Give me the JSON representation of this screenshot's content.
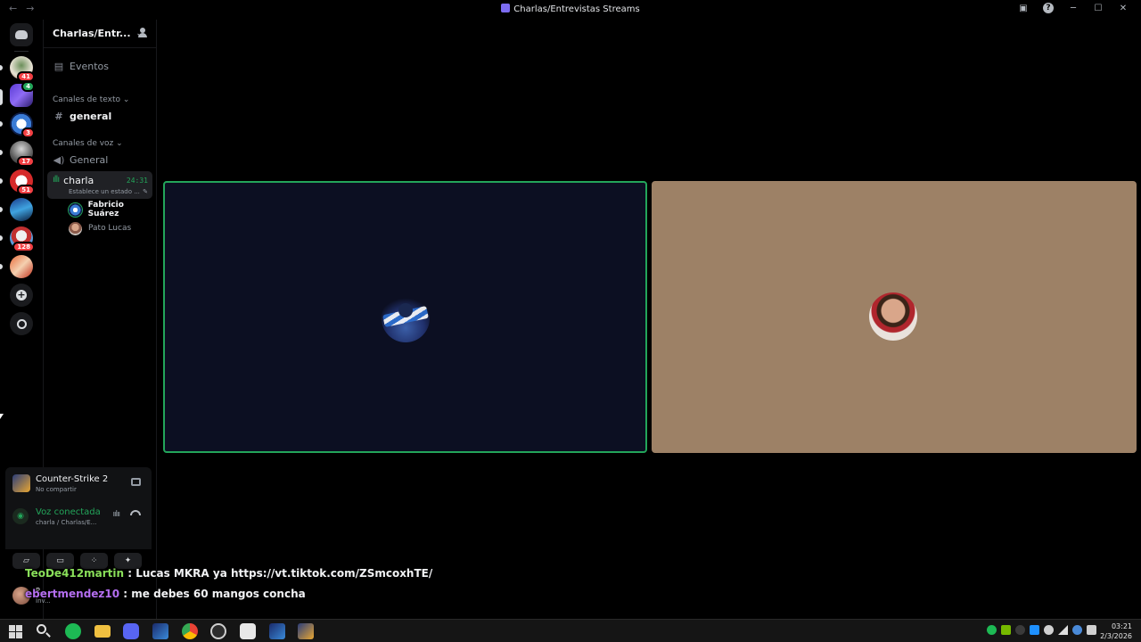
{
  "window": {
    "title": "Charlas/Entrevistas Streams",
    "back": "←",
    "forward": "→",
    "inbox_icon": "inbox-icon",
    "help": "?",
    "minimize": "─",
    "maximize": "☐",
    "close": "✕"
  },
  "rail": {
    "badges": [
      "41",
      "",
      "3",
      "17",
      "51",
      "",
      "128",
      ""
    ],
    "mention_badge": "4"
  },
  "guild": {
    "name": "Charlas/Entr...",
    "events_label": "Eventos",
    "text_category": "Canales de texto",
    "text_channels": [
      {
        "name": "general"
      }
    ],
    "voice_category": "Canales de voz",
    "voice_channels": [
      {
        "name": "General"
      },
      {
        "name": "charla",
        "timer": "24:31",
        "status": "Establece un estado ..."
      }
    ],
    "voice_members": [
      {
        "name": "Fabricio Suárez",
        "speaking": true
      },
      {
        "name": "Pato Lucas",
        "speaking": false
      }
    ]
  },
  "activity": {
    "game": "Counter-Strike 2",
    "sharing": "No compartir"
  },
  "voice_status": {
    "label": "Voz conectada",
    "location": "charla / Charlas/E..."
  },
  "user": {
    "name": "P...",
    "status": "Inv..."
  },
  "chat_overlay": [
    {
      "user": "TeoDe412martin",
      "separator": " : ",
      "message": "Lucas MKRA ya https://vt.tiktok.com/ZSmcoxhTE/"
    },
    {
      "user": "ebertmendez10",
      "separator": " : ",
      "message": "me debes 60 mangos concha"
    }
  ],
  "taskbar": {
    "time": "03:21",
    "date": "2/3/2026"
  },
  "colors": {
    "speaking_border": "#23a55a",
    "tile1_bg": "#0c0f22",
    "tile2_bg": "#9d8166",
    "badge": "#f23f43",
    "chat_user1": "#8ae05a",
    "chat_user2": "#b46ef0"
  }
}
